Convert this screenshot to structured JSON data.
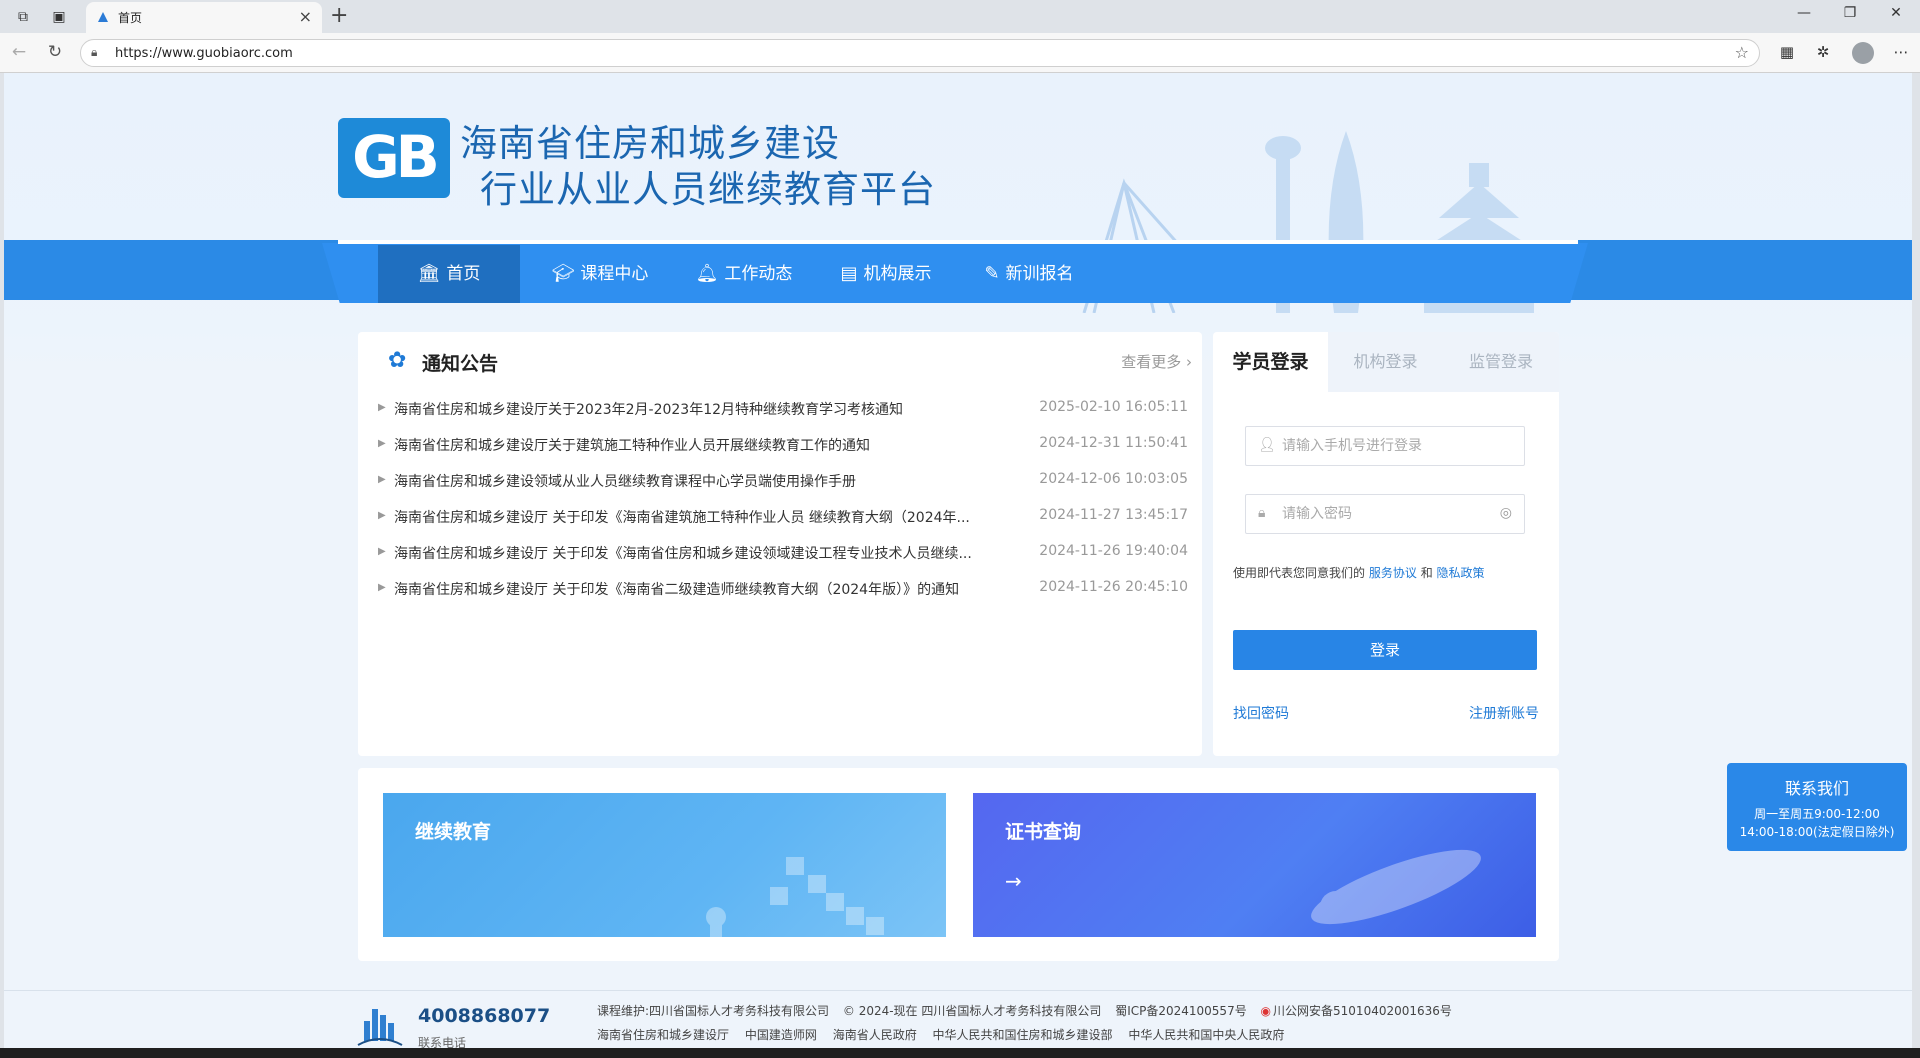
{
  "browser": {
    "tab_title": "首页",
    "url": "https://www.guobiaorc.com"
  },
  "site": {
    "logo_text": "GB",
    "title_line1": "海南省住房和城乡建设",
    "title_line2": "行业从业人员继续教育平台"
  },
  "nav": {
    "items": [
      {
        "label": "首页",
        "icon": "bank-icon",
        "active": true
      },
      {
        "label": "课程中心",
        "icon": "graduation-cap-icon"
      },
      {
        "label": "工作动态",
        "icon": "bell-icon"
      },
      {
        "label": "机构展示",
        "icon": "building-icon"
      },
      {
        "label": "新训报名",
        "icon": "edit-icon"
      }
    ]
  },
  "notice": {
    "title": "通知公告",
    "more": "查看更多",
    "items": [
      {
        "text": "海南省住房和城乡建设厅关于2023年2月-2023年12月特种继续教育学习考核通知",
        "date": "2025-02-10 16:05:11"
      },
      {
        "text": "海南省住房和城乡建设厅关于建筑施工特种作业人员开展继续教育工作的通知",
        "date": "2024-12-31 11:50:41"
      },
      {
        "text": "海南省住房和城乡建设领域从业人员继续教育课程中心学员端使用操作手册",
        "date": "2024-12-06 10:03:05"
      },
      {
        "text": "海南省住房和城乡建设厅 关于印发《海南省建筑施工特种作业人员 继续教育大纲（2024年...",
        "date": "2024-11-27 13:45:17"
      },
      {
        "text": "海南省住房和城乡建设厅 关于印发《海南省住房和城乡建设领域建设工程专业技术人员继续...",
        "date": "2024-11-26 19:40:04"
      },
      {
        "text": "海南省住房和城乡建设厅 关于印发《海南省二级建造师继续教育大纲（2024年版）》的通知",
        "date": "2024-11-26 20:45:10"
      }
    ]
  },
  "login": {
    "tabs": [
      "学员登录",
      "机构登录",
      "监管登录"
    ],
    "phone_placeholder": "请输入手机号进行登录",
    "password_placeholder": "请输入密码",
    "agree_prefix": "使用即代表您同意我们的",
    "service_link": "服务协议",
    "and": "和",
    "privacy_link": "隐私政策",
    "button": "登录",
    "forgot": "找回密码",
    "register": "注册新账号"
  },
  "cards": [
    {
      "title": "继续教育"
    },
    {
      "title": "证书查询",
      "arrow": "→"
    }
  ],
  "contact": {
    "title": "联系我们",
    "hours": "周一至周五9:00-12:00 14:00-18:00(法定假日除外)"
  },
  "footer": {
    "phone": "4008868077",
    "phone_label": "联系电话",
    "line1": [
      "课程维护:四川省国标人才考务科技有限公司",
      "© 2024-现在 四川省国标人才考务科技有限公司",
      "蜀ICP备2024100557号",
      "川公网安备51010402001636号"
    ],
    "line2": [
      "海南省住房和城乡建设厅",
      "中国建造师网",
      "海南省人民政府",
      "中华人民共和国住房和城乡建设部",
      "中华人民共和国中央人民政府"
    ]
  },
  "colors": {
    "primary": "#2b8ae6",
    "nav_active": "#1f6fc0",
    "title_blue": "#1b66b0"
  }
}
